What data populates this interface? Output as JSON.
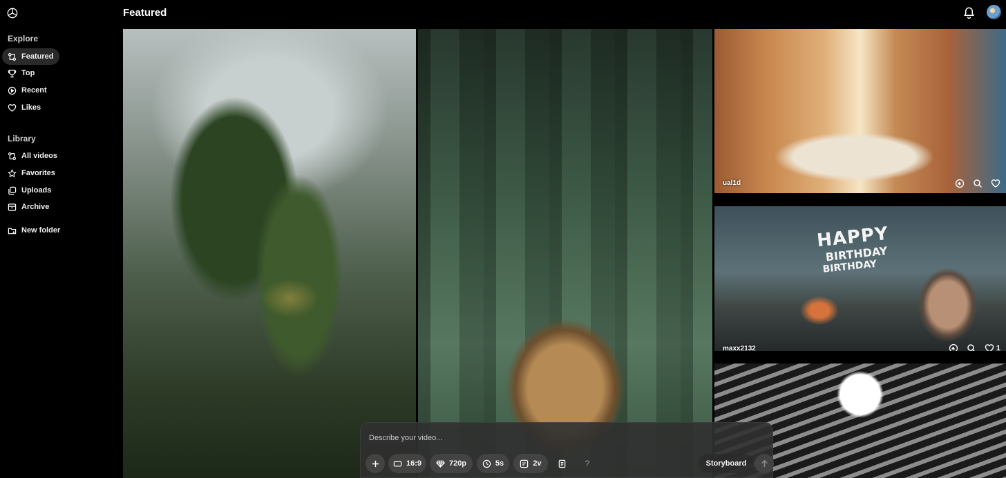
{
  "header": {
    "title": "Featured"
  },
  "sidebar": {
    "explore_title": "Explore",
    "explore_items": [
      {
        "label": "Featured",
        "icon": "featured-icon",
        "active": true
      },
      {
        "label": "Top",
        "icon": "trophy-icon"
      },
      {
        "label": "Recent",
        "icon": "play-circle-icon"
      },
      {
        "label": "Likes",
        "icon": "heart-icon"
      }
    ],
    "library_title": "Library",
    "library_items": [
      {
        "label": "All videos",
        "icon": "videos-icon"
      },
      {
        "label": "Favorites",
        "icon": "star-icon"
      },
      {
        "label": "Uploads",
        "icon": "uploads-icon"
      },
      {
        "label": "Archive",
        "icon": "archive-icon"
      }
    ],
    "new_folder": "New folder"
  },
  "tiles": [
    {
      "id": "dino",
      "user": ""
    },
    {
      "id": "cub",
      "user": ""
    },
    {
      "id": "sheep",
      "user": "ual1d",
      "likes": ""
    },
    {
      "id": "bday",
      "user": "maxx2132",
      "likes": "1",
      "overlay_lines": [
        "HAPPY",
        "BIRTHDAY",
        "BIRTHDAY"
      ]
    },
    {
      "id": "lamp",
      "user": ""
    }
  ],
  "composer": {
    "placeholder": "Describe your video...",
    "aspect": "16:9",
    "resolution": "720p",
    "duration": "5s",
    "variations": "2v",
    "help": "?",
    "storyboard": "Storyboard"
  },
  "colors": {
    "background": "#000000",
    "active_nav": "#2a2a2a",
    "composer": "#303030"
  }
}
